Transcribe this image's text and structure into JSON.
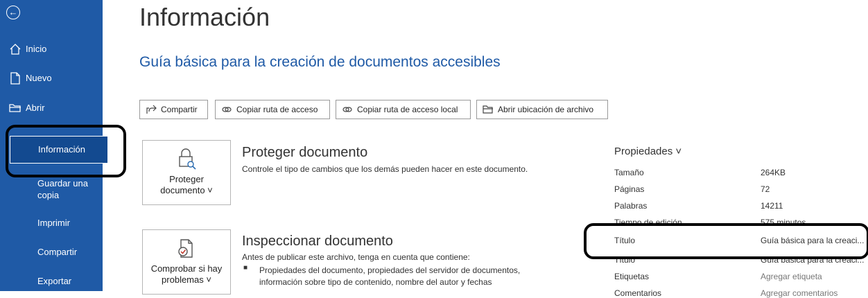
{
  "sidebar": {
    "back_glyph": "←",
    "items": [
      {
        "label": "Inicio",
        "icon": "home-icon"
      },
      {
        "label": "Nuevo",
        "icon": "new-document-icon"
      },
      {
        "label": "Abrir",
        "icon": "folder-icon"
      },
      {
        "label": "Información",
        "selected": true
      },
      {
        "label": "Guardar una copia"
      },
      {
        "label": "Imprimir"
      },
      {
        "label": "Compartir"
      },
      {
        "label": "Exportar"
      }
    ]
  },
  "main": {
    "title": "Información",
    "document_title": "Guía básica para la creación de documentos accesibles",
    "toolbar": [
      {
        "label": "Compartir",
        "icon": "share-icon"
      },
      {
        "label": "Copiar ruta de acceso",
        "icon": "link-icon"
      },
      {
        "label": "Copiar ruta de acceso local",
        "icon": "link-icon"
      },
      {
        "label": "Abrir ubicación de archivo",
        "icon": "folder-icon"
      }
    ],
    "protect": {
      "button_line1": "Proteger",
      "button_line2": "documento ˅",
      "title": "Proteger documento",
      "desc": "Controle el tipo de cambios que los demás pueden hacer en este documento."
    },
    "inspect": {
      "button_line1": "Comprobar si hay",
      "button_line2": "problemas ˅",
      "title": "Inspeccionar documento",
      "desc": "Antes de publicar este archivo, tenga en cuenta que contiene:",
      "bullet": "Propiedades del documento, propiedades del servidor de documentos, información sobre tipo de contenido, nombre del autor y fechas"
    }
  },
  "properties": {
    "title": "Propiedades ˅",
    "rows": [
      {
        "label": "Tamaño",
        "value": "264KB"
      },
      {
        "label": "Páginas",
        "value": "72"
      },
      {
        "label": "Palabras",
        "value": "14211"
      },
      {
        "label": "Tiempo de edición",
        "value": "575 minutos"
      },
      {
        "label": "Título",
        "value": "Guía básica para la creaci..."
      },
      {
        "label": "Etiquetas",
        "value": "Agregar etiqueta",
        "muted": true
      },
      {
        "label": "Comentarios",
        "value": "Agregar comentarios",
        "muted": true
      }
    ]
  },
  "colors": {
    "sidebar": "#1f5aa6",
    "accent": "#1f5aa6",
    "highlight": "#000000"
  }
}
